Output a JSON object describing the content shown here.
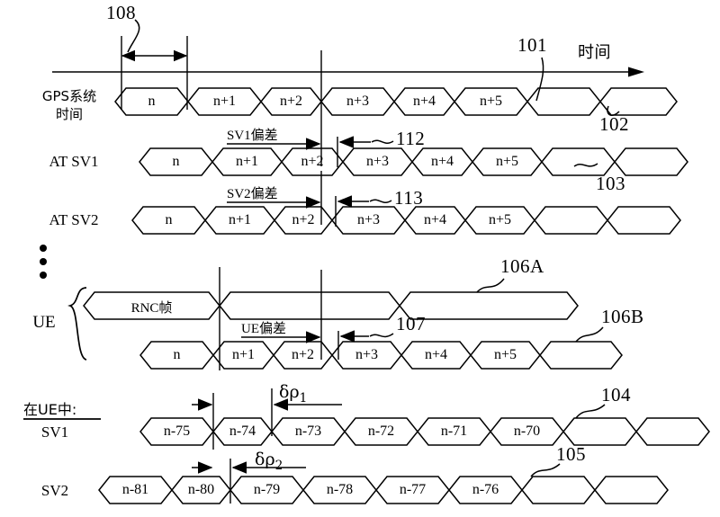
{
  "figure": {
    "type": "timing-diagram",
    "axis_label": "时间",
    "axis_ref": "101",
    "interval_ref": "108"
  },
  "rows": [
    {
      "id": "gps",
      "label_line1": "GPS系统",
      "label_line2": "时间",
      "segments": [
        "n",
        "n+1",
        "n+2",
        "n+3",
        "n+4",
        "n+5",
        "",
        ""
      ],
      "ref": "102"
    },
    {
      "id": "at-sv1",
      "label_line1": "AT SV1",
      "label_line2": "",
      "segments": [
        "n",
        "n+1",
        "n+2",
        "n+3",
        "n+4",
        "n+5",
        "",
        ""
      ],
      "ref": "103"
    },
    {
      "id": "at-sv2",
      "label_line1": "AT SV2",
      "label_line2": "",
      "segments": [
        "n",
        "n+1",
        "n+2",
        "n+3",
        "n+4",
        "n+5",
        "",
        ""
      ],
      "ref": ""
    },
    {
      "id": "ue-rnc",
      "label_line1": "",
      "label_line2": "",
      "segments": [
        "RNC帧",
        "",
        ""
      ],
      "ref": "106A"
    },
    {
      "id": "ue-frames",
      "label_line1": "",
      "label_line2": "",
      "segments": [
        "n",
        "n+1",
        "n+2",
        "n+3",
        "n+4",
        "n+5",
        ""
      ],
      "ref": "106B"
    },
    {
      "id": "sv1",
      "label_line1": "SV1",
      "label_line2": "",
      "segments": [
        "n-75",
        "n-74",
        "n-73",
        "n-72",
        "n-71",
        "n-70",
        "",
        ""
      ],
      "ref": "104"
    },
    {
      "id": "sv2",
      "label_line1": "SV2",
      "label_line2": "",
      "segments": [
        "n-81",
        "n-80",
        "n-79",
        "n-78",
        "n-77",
        "n-76",
        "",
        ""
      ],
      "ref": "105"
    }
  ],
  "group_labels": {
    "ue": "UE",
    "in_ue": "在UE中:"
  },
  "annotations": {
    "sv1_offset": "SV1偏差",
    "sv2_offset": "SV2偏差",
    "ue_offset": "UE偏差",
    "ref_112": "112",
    "ref_113": "113",
    "ref_107": "107",
    "delta_rho_1_sym": "δρ",
    "delta_rho_1_sub": "1",
    "delta_rho_2_sym": "δρ",
    "delta_rho_2_sub": "2"
  },
  "colors": {
    "ink": "#000000",
    "paper": "#ffffff"
  }
}
